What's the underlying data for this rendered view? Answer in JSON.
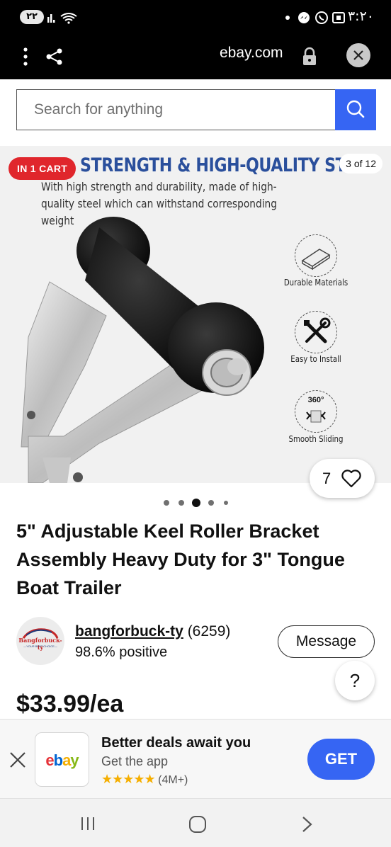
{
  "status_bar": {
    "badge": "٢٢",
    "time": "٣:٢٠"
  },
  "browser": {
    "url": "ebay.com"
  },
  "search": {
    "placeholder": "Search for anything"
  },
  "gallery": {
    "cart_badge": "IN 1 CART",
    "headline": "STRENGTH & HIGH-QUALITY STEEL",
    "subtext": "With high strength and durability, made of high-quality steel which can withstand corresponding weight",
    "counter": "3 of 12",
    "features": [
      {
        "label": "Durable Materials",
        "icon": "steel-plate-icon"
      },
      {
        "label": "Easy to Install",
        "icon": "tools-icon"
      },
      {
        "label": "Smooth Sliding",
        "icon": "rotation-360-icon",
        "icon_text": "360°"
      }
    ],
    "watch_count": "7",
    "dots": {
      "count": 5,
      "active": 2
    }
  },
  "product": {
    "title": "5\" Adjustable Keel Roller Bracket Assembly Heavy Duty for 3\" Tongue Boat Trailer",
    "price": "$33.99/ea"
  },
  "seller": {
    "name": "bangforbuck-ty",
    "score": "(6259)",
    "positive": "98.6% positive",
    "logo_text": "Bangforbuck-ty",
    "logo_tagline": "—YOUR BEST CHOICE—",
    "message_label": "Message"
  },
  "help": {
    "label": "?"
  },
  "app_banner": {
    "logo": [
      "e",
      "b",
      "a",
      "y"
    ],
    "logo_colors": [
      "#e53238",
      "#0064d2",
      "#f5af02",
      "#86b817"
    ],
    "title": "Better deals await you",
    "subtitle": "Get the app",
    "stars": "★★★★★",
    "rating_count": "(4M+)",
    "get_label": "GET"
  },
  "colors": {
    "accent": "#3665f3",
    "cart_badge": "#e0262c",
    "headline": "#2a4f9c"
  }
}
